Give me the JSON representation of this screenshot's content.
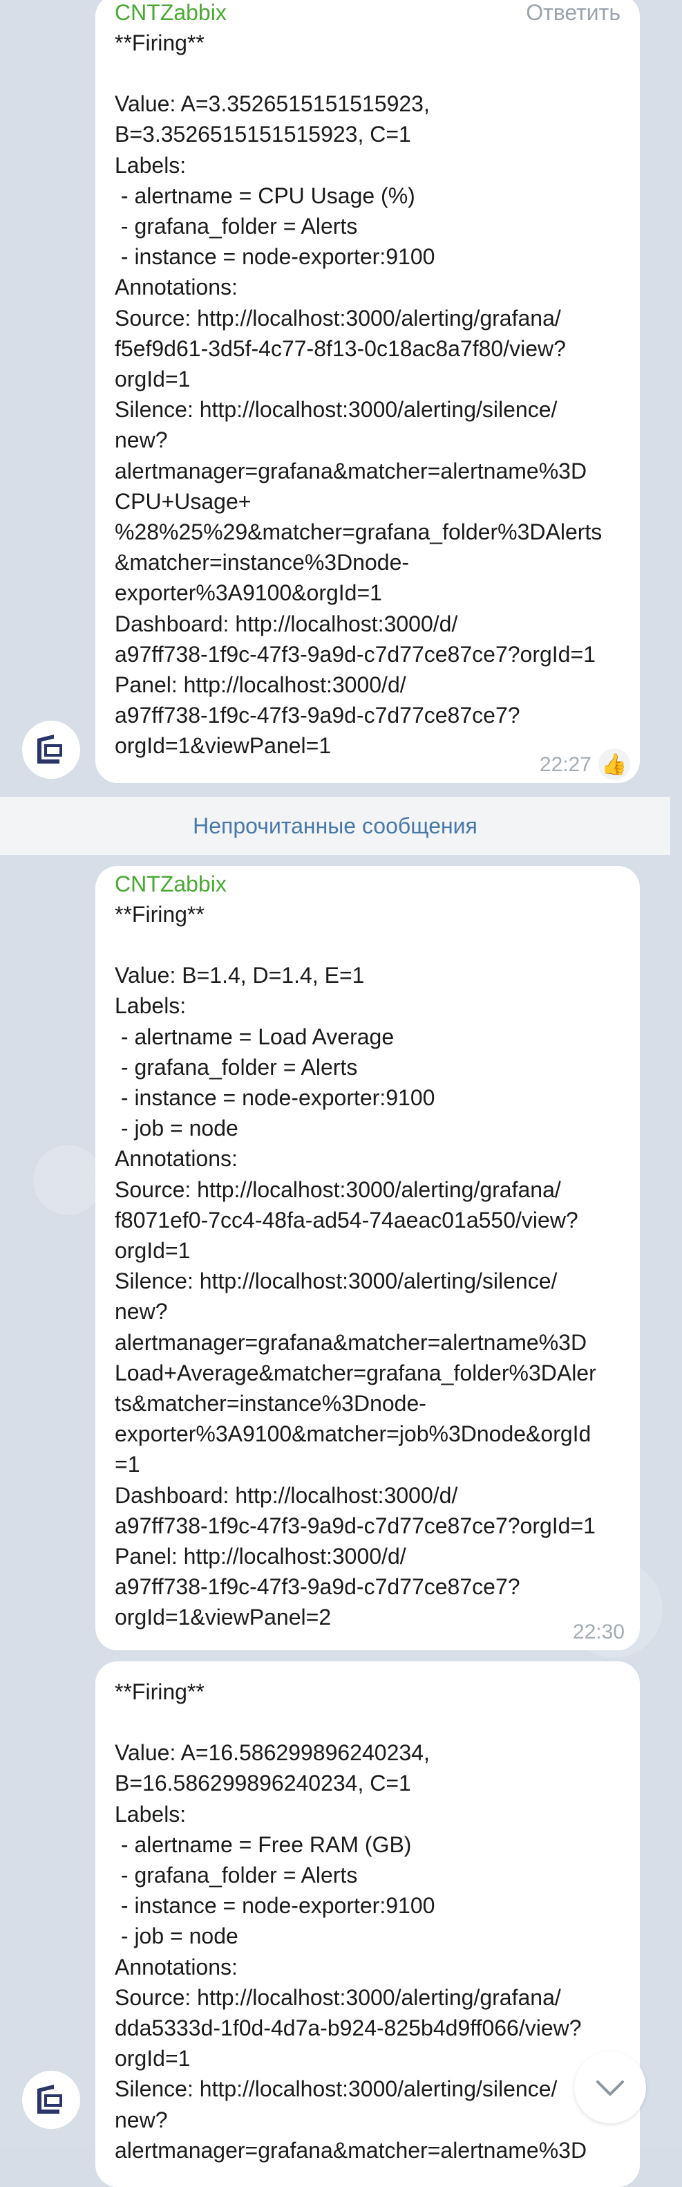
{
  "messages": [
    {
      "sender": "CNTZabbix",
      "reply_label": "Ответить",
      "time": "22:27",
      "reaction": "👍",
      "lines": [
        "**Firing**",
        "",
        "Value: A=3.3526515151515923,",
        "B=3.3526515151515923, C=1",
        "Labels:",
        " - alertname = CPU Usage (%)",
        " - grafana_folder = Alerts",
        " - instance = node-exporter:9100",
        "Annotations:",
        "Source: http://localhost:3000/alerting/grafana/",
        "f5ef9d61-3d5f-4c77-8f13-0c18ac8a7f80/view?",
        "orgId=1",
        "Silence: http://localhost:3000/alerting/silence/",
        "new?",
        "alertmanager=grafana&matcher=alertname%3D",
        "CPU+Usage+",
        "%28%25%29&matcher=grafana_folder%3DAlerts",
        "&matcher=instance%3Dnode-",
        "exporter%3A9100&orgId=1",
        "Dashboard: http://localhost:3000/d/",
        "a97ff738-1f9c-47f3-9a9d-c7d77ce87ce7?orgId=1",
        "Panel: http://localhost:3000/d/",
        "a97ff738-1f9c-47f3-9a9d-c7d77ce87ce7?",
        "orgId=1&viewPanel=1"
      ]
    },
    {
      "sender": "CNTZabbix",
      "time": "22:30",
      "lines": [
        "**Firing**",
        "",
        "Value: B=1.4, D=1.4, E=1",
        "Labels:",
        " - alertname = Load Average",
        " - grafana_folder = Alerts",
        " - instance = node-exporter:9100",
        " - job = node",
        "Annotations:",
        "Source: http://localhost:3000/alerting/grafana/",
        "f8071ef0-7cc4-48fa-ad54-74aeac01a550/view?",
        "orgId=1",
        "Silence: http://localhost:3000/alerting/silence/",
        "new?",
        "alertmanager=grafana&matcher=alertname%3D",
        "Load+Average&matcher=grafana_folder%3DAler",
        "ts&matcher=instance%3Dnode-",
        "exporter%3A9100&matcher=job%3Dnode&orgId",
        "=1",
        "Dashboard: http://localhost:3000/d/",
        "a97ff738-1f9c-47f3-9a9d-c7d77ce87ce7?orgId=1",
        "Panel: http://localhost:3000/d/",
        "a97ff738-1f9c-47f3-9a9d-c7d77ce87ce7?",
        "orgId=1&viewPanel=2"
      ]
    },
    {
      "lines": [
        "**Firing**",
        "",
        "Value: A=16.586299896240234,",
        "B=16.586299896240234, C=1",
        "Labels:",
        " - alertname = Free RAM (GB)",
        " - grafana_folder = Alerts",
        " - instance = node-exporter:9100",
        " - job = node",
        "Annotations:",
        "Source: http://localhost:3000/alerting/grafana/",
        "dda5333d-1f0d-4d7a-b924-825b4d9ff066/view?",
        "orgId=1",
        "Silence: http://localhost:3000/alerting/silence/",
        "new?",
        "alertmanager=grafana&matcher=alertname%3D"
      ]
    }
  ],
  "unread_divider": "Непрочитанные сообщения",
  "icons": {
    "avatar": "cntzabbix-logo-icon",
    "scroll_down": "chevron-down-icon",
    "reaction": "thumbs-up-icon"
  },
  "colors": {
    "sender": "#49a932",
    "divider_text": "#4879a8",
    "background": "#d7dee8",
    "bubble": "#ffffff",
    "time": "#a3acb4"
  }
}
